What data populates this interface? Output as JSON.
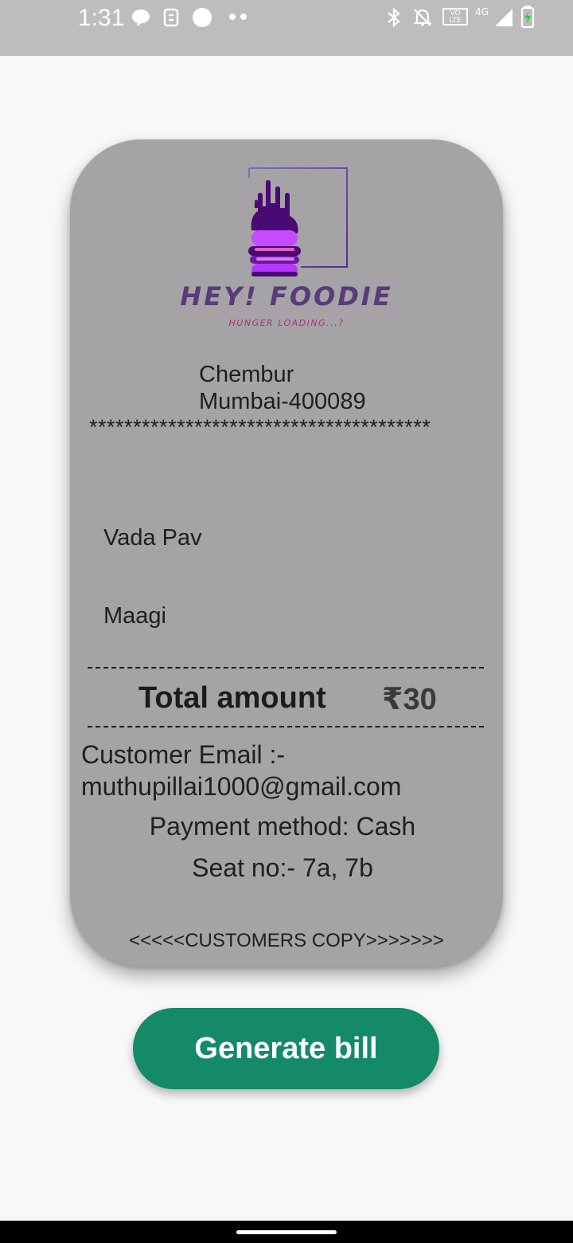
{
  "status_bar": {
    "time": "1:31",
    "left_icons": [
      "chat-bubble-icon",
      "sim-icon",
      "record-dot-icon",
      "more-dots-icon"
    ],
    "right_icons": [
      "bluetooth-icon",
      "notifications-off-icon",
      "volte-icon",
      "signal-4g-icon",
      "battery-charging-icon"
    ],
    "volte_label": "VO LTE",
    "network_label": "4G"
  },
  "receipt": {
    "logo": {
      "brand": "HEY! FOODIE",
      "tagline": "HUNGER LOADING...?"
    },
    "address_line1": "Chembur",
    "address_line2": "Mumbai-400089",
    "separator": "***************************************",
    "items": [
      {
        "name": "Vada Pav"
      },
      {
        "name": "Maagi"
      }
    ],
    "total_label": "Total amount",
    "total_value": "₹30",
    "customer_email_label": "Customer Email :-",
    "customer_email": "muthupillai1000@gmail.com",
    "payment_method": "Payment method: Cash",
    "seat": "Seat no:- 7a, 7b",
    "copy_label": "<<<<<CUSTOMERS COPY>>>>>>>"
  },
  "actions": {
    "generate_bill": "Generate bill"
  },
  "colors": {
    "receipt_bg": "#a5a3a6",
    "button_bg": "#148a66",
    "logo_purple": "#6a0dad",
    "logo_magenta": "#c44bff"
  }
}
